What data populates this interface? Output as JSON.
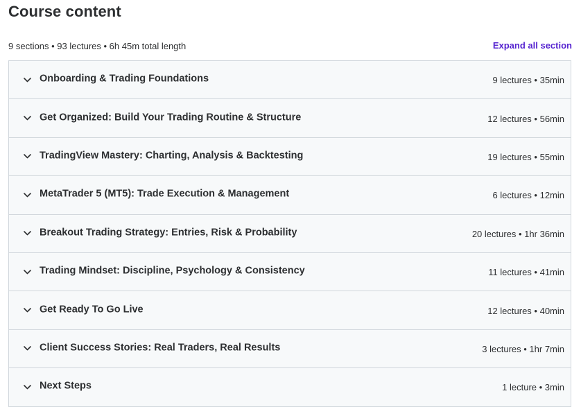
{
  "header": {
    "title": "Course content",
    "summary": "9 sections • 93 lectures • 6h 45m total length",
    "expand_all_label": "Expand all section"
  },
  "sections": [
    {
      "title": "Onboarding & Trading Foundations",
      "meta": "9 lectures • 35min"
    },
    {
      "title": "Get Organized: Build Your Trading Routine & Structure",
      "meta": "12 lectures • 56min"
    },
    {
      "title": "TradingView Mastery: Charting, Analysis & Backtesting",
      "meta": "19 lectures • 55min"
    },
    {
      "title": "MetaTrader 5 (MT5): Trade Execution & Management",
      "meta": "6 lectures • 12min"
    },
    {
      "title": "Breakout Trading Strategy: Entries, Risk & Probability",
      "meta": "20 lectures • 1hr 36min"
    },
    {
      "title": "Trading Mindset: Discipline, Psychology & Consistency",
      "meta": "11 lectures • 41min"
    },
    {
      "title": "Get Ready To Go Live",
      "meta": "12 lectures • 40min"
    },
    {
      "title": "Client Success Stories: Real Traders, Real Results",
      "meta": "3 lectures • 1hr 7min"
    },
    {
      "title": "Next Steps",
      "meta": "1 lecture • 3min"
    }
  ],
  "icons": {
    "section_toggle": "chevron-down-icon"
  },
  "colors": {
    "accent": "#5624d0",
    "text": "#2d2f31",
    "section_bg": "#f7f9fa",
    "border": "#d1d7dc"
  }
}
